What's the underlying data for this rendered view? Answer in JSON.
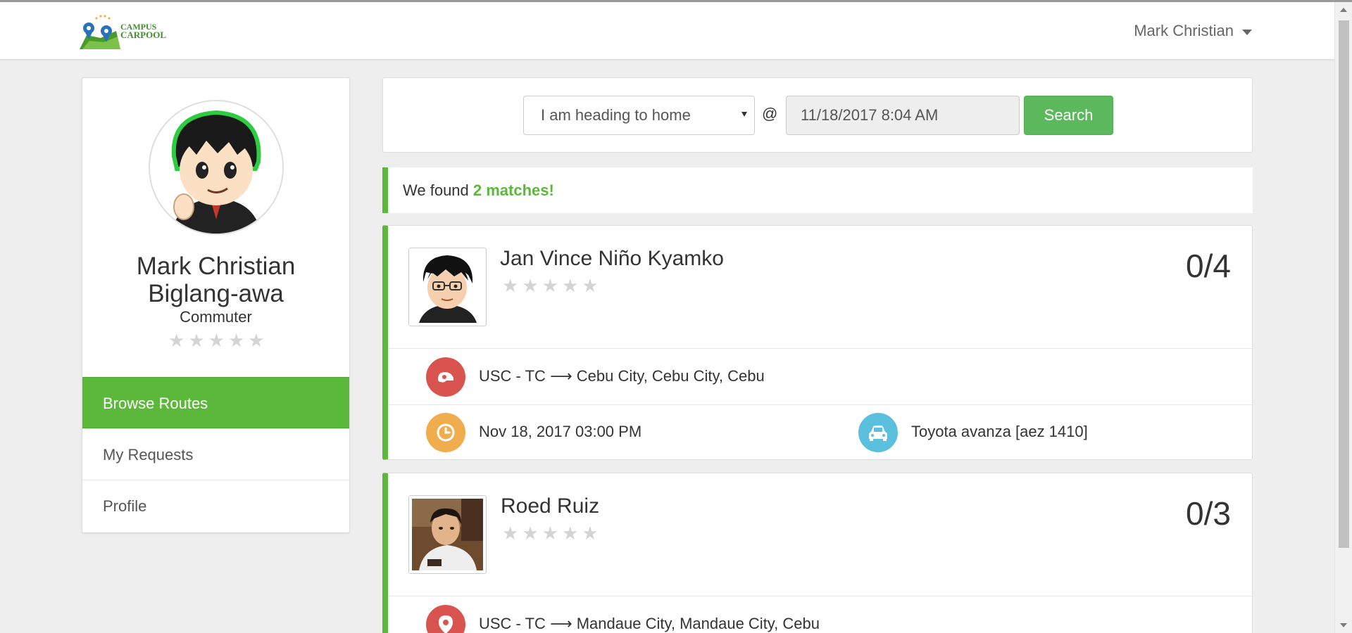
{
  "app": {
    "logo_line1": "CAMPUS",
    "logo_line2": "CARPOOL",
    "user_menu": "Mark Christian"
  },
  "colors": {
    "accent_green": "#5cb83b",
    "button_green": "#5cb85c",
    "route_icon_red": "#d9534f",
    "time_icon_orange": "#f0ad4e",
    "car_icon_blue": "#5bc0de"
  },
  "profile": {
    "name_line1": "Mark Christian",
    "name_line2": "Biglang-awa",
    "role": "Commuter",
    "rating": 0,
    "rating_max": 5
  },
  "sidebar": {
    "items": [
      {
        "label": "Browse Routes",
        "active": true
      },
      {
        "label": "My Requests",
        "active": false
      },
      {
        "label": "Profile",
        "active": false
      }
    ]
  },
  "search": {
    "direction_selected": "I am heading to home",
    "at_symbol": "@",
    "datetime_value": "11/18/2017 8:04 AM",
    "button_label": "Search"
  },
  "results": {
    "prefix": "We found ",
    "count_text": "2 matches!"
  },
  "routes": [
    {
      "driver": "Jan Vince Niño Kyamko",
      "rating": 0,
      "seats": "0/4",
      "origin": "USC - TC",
      "arrow": "⟶",
      "destination": "Cebu City, Cebu City, Cebu",
      "datetime": "Nov 18, 2017 03:00 PM",
      "vehicle": "Toyota avanza [aez 1410]"
    },
    {
      "driver": "Roed Ruiz",
      "rating": 0,
      "seats": "0/3",
      "origin": "USC - TC",
      "arrow": "⟶",
      "destination": "Mandaue City, Mandaue City, Cebu"
    }
  ]
}
